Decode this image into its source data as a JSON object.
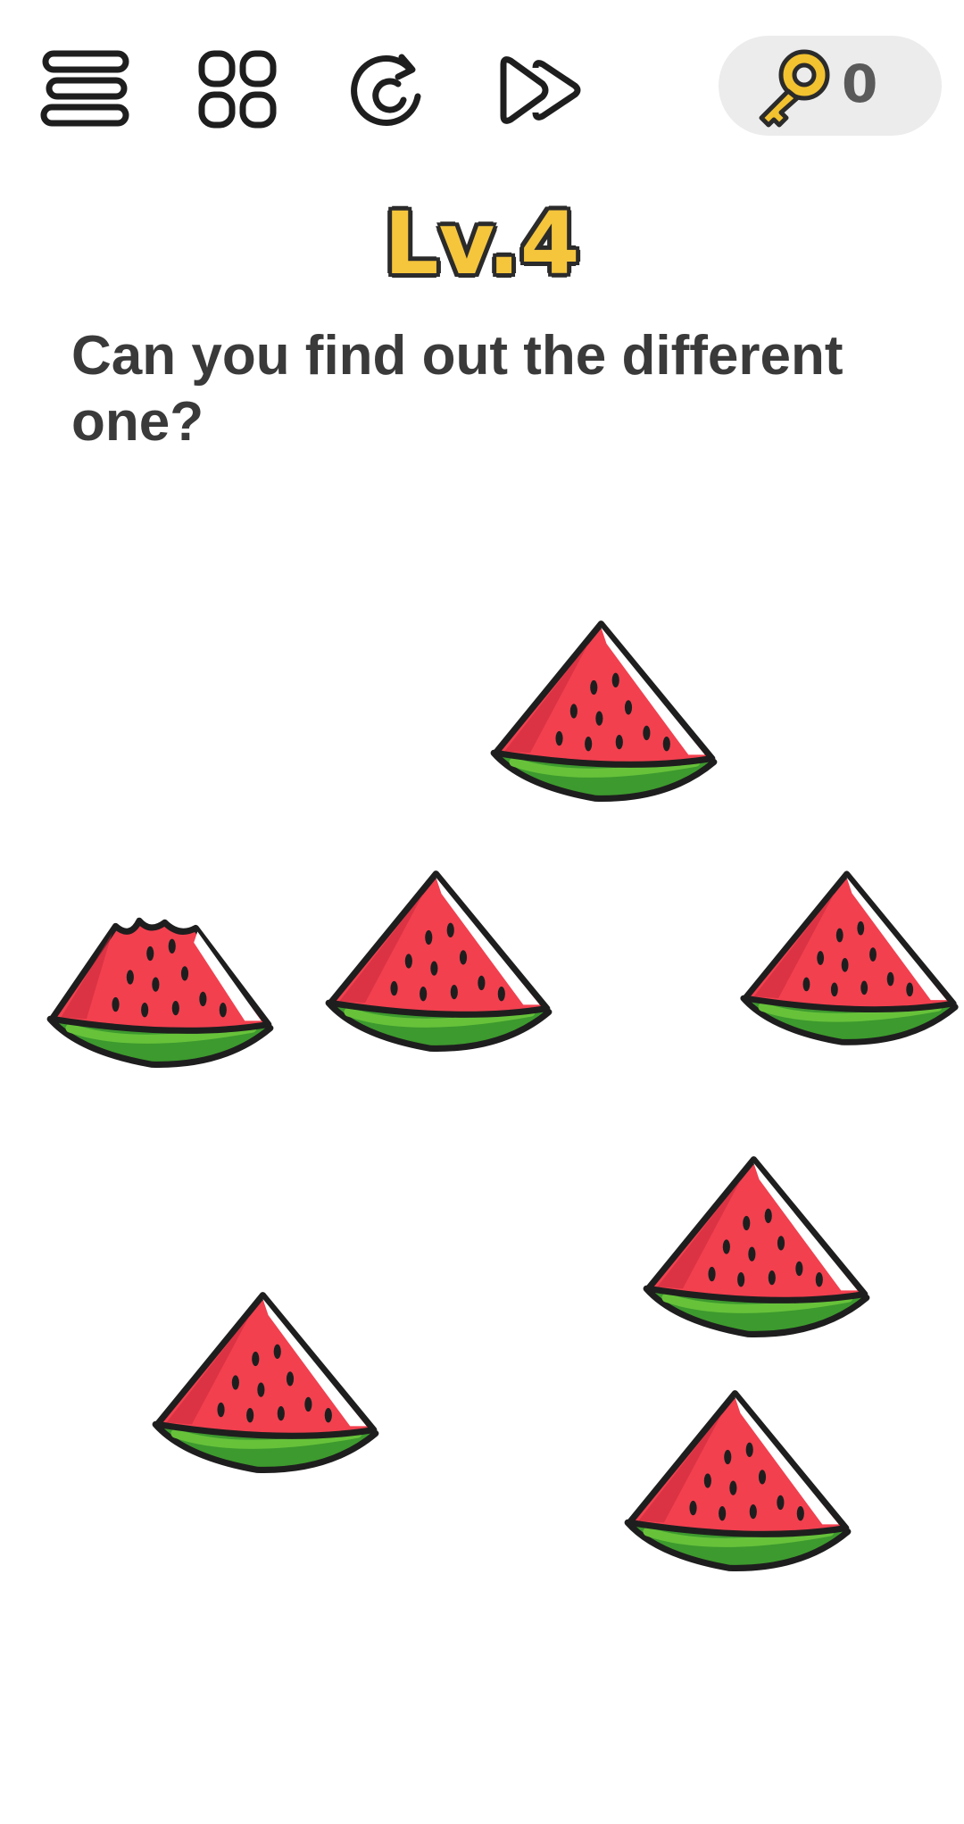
{
  "topbar": {
    "menu_icon": "menu-icon",
    "levels_icon": "grid-icon",
    "restart_icon": "restart-icon",
    "skip_icon": "skip-forward-icon",
    "key_icon": "key-icon",
    "key_count": "0"
  },
  "level": {
    "title": "Lv.4"
  },
  "question": {
    "text": "Can you find out the different one?"
  },
  "puzzle": {
    "items": [
      {
        "name": "watermelon-slice-1",
        "bitten": false
      },
      {
        "name": "watermelon-slice-2",
        "bitten": true
      },
      {
        "name": "watermelon-slice-3",
        "bitten": false
      },
      {
        "name": "watermelon-slice-4",
        "bitten": false
      },
      {
        "name": "watermelon-slice-5",
        "bitten": false
      },
      {
        "name": "watermelon-slice-6",
        "bitten": false
      },
      {
        "name": "watermelon-slice-7",
        "bitten": false
      }
    ]
  },
  "colors": {
    "level_fill": "#f5c53c",
    "key_color": "#f2c230",
    "melon_flesh": "#f2404f",
    "melon_shadow": "#c8283a",
    "melon_rind": "#3d9a2e",
    "melon_rind_light": "#67c23a",
    "outline": "#1e1e1e"
  }
}
